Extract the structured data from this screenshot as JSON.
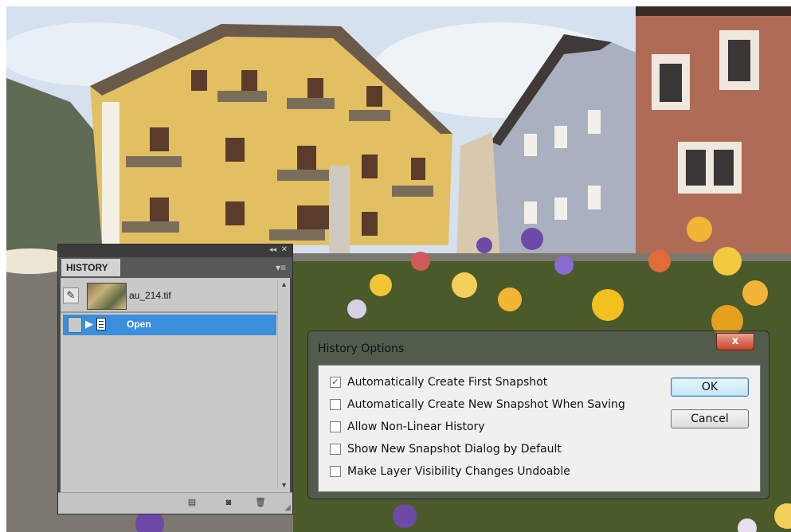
{
  "history_panel": {
    "tab_label": "HISTORY",
    "collapse_glyph": "◂◂",
    "close_glyph": "✕",
    "menu_glyph": "▾≡",
    "snapshot": {
      "name": "au_214.tif",
      "source_icon": "history-brush-icon"
    },
    "states": [
      {
        "label": "Open",
        "selected": true,
        "icon": "document-icon"
      }
    ],
    "footer": {
      "new_document_icon": "new-document-from-state-icon",
      "new_snapshot_icon": "camera-icon",
      "delete_icon": "trash-icon"
    }
  },
  "dialog": {
    "title": "History Options",
    "close_label": "x",
    "options": [
      {
        "label": "Automatically Create First Snapshot",
        "checked": true
      },
      {
        "label": "Automatically Create New Snapshot When Saving",
        "checked": false
      },
      {
        "label": "Allow Non-Linear History",
        "checked": false
      },
      {
        "label": "Show New Snapshot Dialog by Default",
        "checked": false
      },
      {
        "label": "Make Layer Visibility Changes Undoable",
        "checked": false
      }
    ],
    "ok_label": "OK",
    "cancel_label": "Cancel"
  },
  "colors": {
    "selection_blue": "#3b8edb",
    "panel_dark": "#4a4a4a",
    "panel_light": "#c9c9c9",
    "dialog_close_red": "#c9452b"
  }
}
